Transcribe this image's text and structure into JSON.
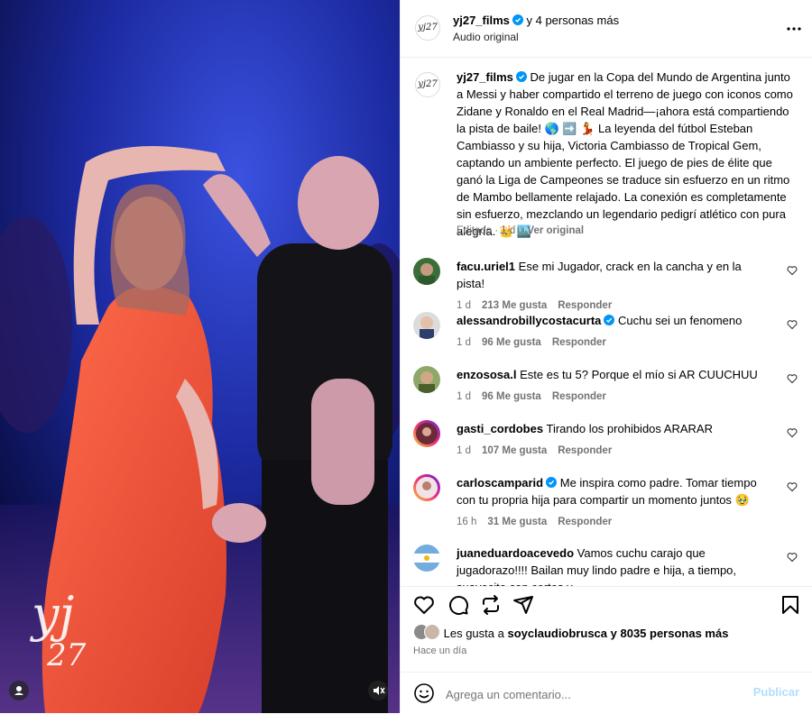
{
  "header": {
    "username": "yj27_films",
    "collab_text": "y 4 personas más",
    "audio": "Audio original",
    "avatar_text": "yj27"
  },
  "caption": {
    "username": "yj27_films",
    "text": "De jugar en la Copa del Mundo de Argentina junto a Messi y haber compartido el terreno de juego con iconos como Zidane y Ronaldo en el Real Madrid—¡ahora está compartiendo la pista de baile! 🌎 ➡️ 💃 La leyenda del fútbol Esteban Cambiasso y su hija, Victoria Cambiasso de Tropical Gem, captando un ambiente perfecto. El juego de pies de élite que ganó la Liga de Campeones se traduce sin esfuerzo en un ritmo de Mambo bellamente relajado. La conexión es completamente sin esfuerzo, mezclando un legendario pedigrí atlético con pura alegría. 👑 🏙️",
    "edited": "Editado · 1 d",
    "see_original": "Ver original"
  },
  "comments": [
    {
      "user": "facu.uriel1",
      "verified": false,
      "text": "Ese mi Jugador, crack en la cancha y en la pista!",
      "time": "1 d",
      "likes": "213 Me gusta",
      "reply": "Responder"
    },
    {
      "user": "alessandrobillycostacurta",
      "verified": true,
      "text": "Cuchu sei un fenomeno",
      "time": "1 d",
      "likes": "96 Me gusta",
      "reply": "Responder"
    },
    {
      "user": "enzososa.l",
      "verified": false,
      "text": "Este es tu 5? Porque el mío si AR CUUCHUU",
      "time": "1 d",
      "likes": "96 Me gusta",
      "reply": "Responder"
    },
    {
      "user": "gasti_cordobes",
      "verified": false,
      "text": "Tirando los prohibidos ARARAR",
      "time": "1 d",
      "likes": "107 Me gusta",
      "reply": "Responder"
    },
    {
      "user": "carloscamparid",
      "verified": true,
      "text": "Me inspira como padre. Tomar tiempo con tu propria hija para compartir un momento juntos 🥹",
      "time": "16 h",
      "likes": "31 Me gusta",
      "reply": "Responder"
    },
    {
      "user": "juaneduardoacevedo",
      "verified": false,
      "text": "Vamos cuchu carajo que jugadorazo!!!! Bailan muy lindo padre e hija, a tiempo, suavecito con cortes y",
      "time": "",
      "likes": "",
      "reply": ""
    }
  ],
  "likes": {
    "prefix": "Les gusta a",
    "user": "soyclaudiobrusca",
    "suffix": "y 8035 personas más"
  },
  "posted": "Hace un día",
  "composer": {
    "placeholder": "Agrega un comentario...",
    "post_label": "Publicar"
  },
  "media": {
    "watermark": "yj27"
  },
  "colors": {
    "verified": "#0095f6",
    "muted": "#737373",
    "publish_disabled": "#b2dffc"
  }
}
